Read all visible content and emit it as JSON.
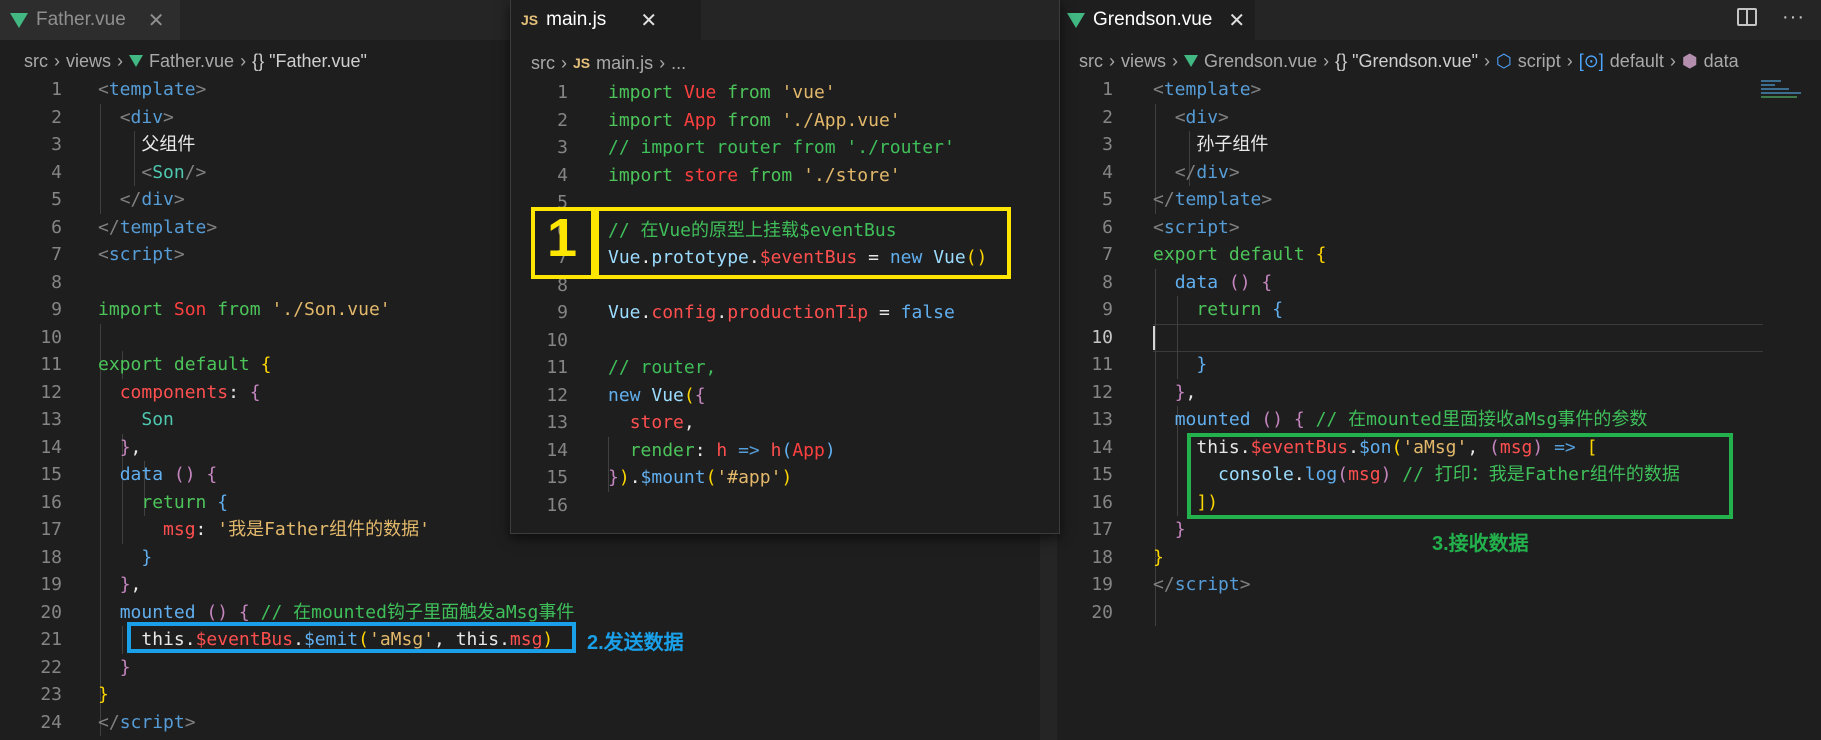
{
  "left": {
    "tab": {
      "title": "Father.vue",
      "close": "✕"
    },
    "breadcrumb": [
      "src",
      "views",
      "Father.vue",
      "{} \"Father.vue\""
    ],
    "lines": [
      "1",
      "2",
      "3",
      "4",
      "5",
      "6",
      "7",
      "8",
      "9",
      "10",
      "11",
      "12",
      "13",
      "14",
      "15",
      "16",
      "17",
      "18",
      "19",
      "20",
      "21",
      "22",
      "23",
      "24"
    ],
    "annotation": "2.发送数据"
  },
  "middle": {
    "tab": {
      "icon": "JS",
      "title": "main.js",
      "close": "✕"
    },
    "breadcrumb": [
      "src",
      "JS",
      "main.js",
      "..."
    ],
    "annotation_number": "1"
  },
  "right": {
    "tab": {
      "title": "Grendson.vue",
      "close": "✕"
    },
    "breadcrumb": [
      "src",
      "views",
      "Grendson.vue",
      "{} \"Grendson.vue\"",
      "script",
      "default",
      "data"
    ],
    "annotation": "3.接收数据"
  },
  "colors": {
    "yellow_box": "#ffe600",
    "blue_box": "#1aa0e8",
    "green_box": "#22b14c",
    "editor_bg": "#1e1e1e"
  },
  "icons": [
    "vue-file-icon",
    "js-file-icon",
    "close-icon",
    "split-editor-icon",
    "more-actions-icon"
  ]
}
